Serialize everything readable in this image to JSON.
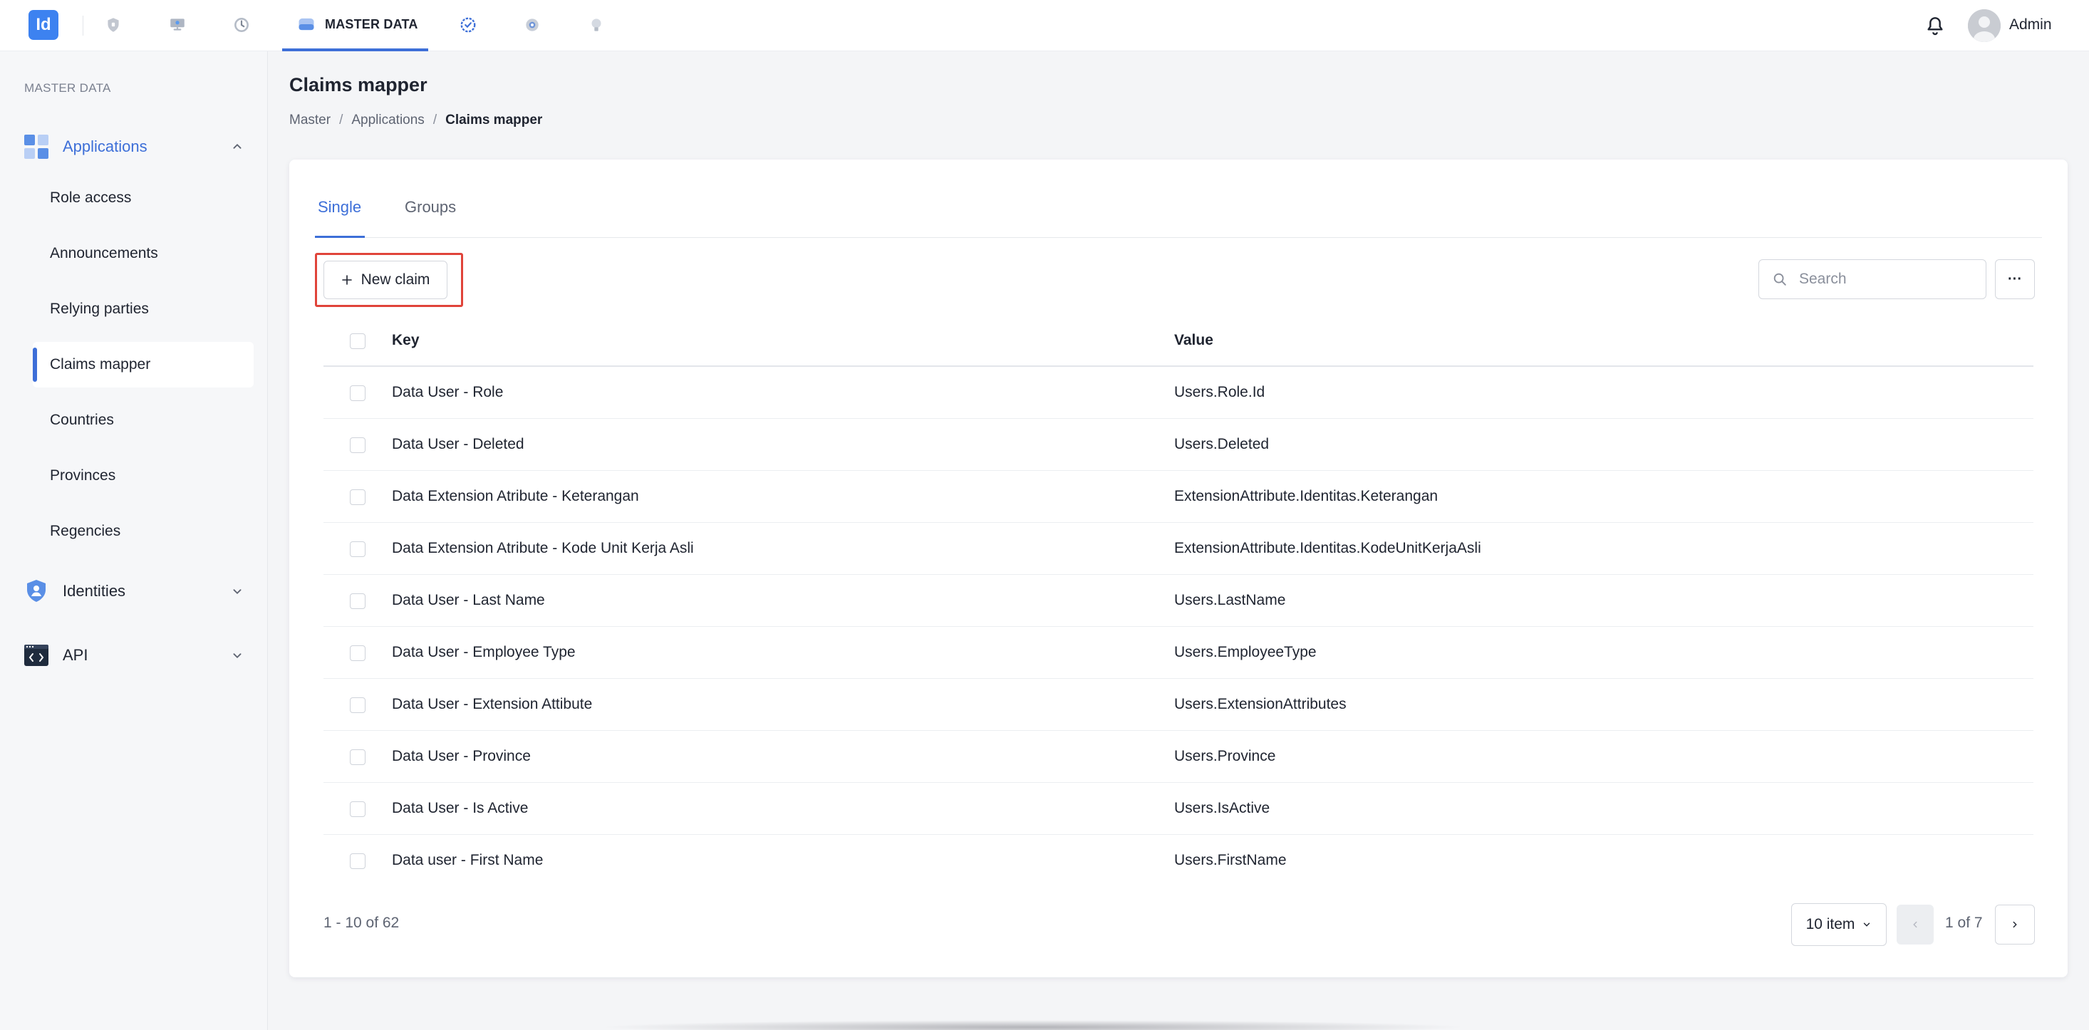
{
  "app": {
    "logo_text": "Id",
    "accent_color": "#3d6fd8",
    "logo_color": "#3d82f0"
  },
  "topbar": {
    "icons": [
      "shield-icon",
      "desktop-user-icon",
      "history-icon",
      "database-icon",
      "check-circle-icon",
      "gear-icon",
      "lightbulb-icon"
    ],
    "active_label": "MASTER DATA",
    "user_name": "Admin"
  },
  "sidebar": {
    "section_label": "MASTER DATA",
    "groups": [
      {
        "label": "Applications",
        "icon": "grid-apps-icon",
        "expanded": true,
        "items": [
          {
            "label": "Role access",
            "active": false
          },
          {
            "label": "Announcements",
            "active": false
          },
          {
            "label": "Relying parties",
            "active": false
          },
          {
            "label": "Claims mapper",
            "active": true
          },
          {
            "label": "Countries",
            "active": false
          },
          {
            "label": "Provinces",
            "active": false
          },
          {
            "label": "Regencies",
            "active": false
          }
        ]
      },
      {
        "label": "Identities",
        "icon": "identity-shield-icon",
        "expanded": false
      },
      {
        "label": "API",
        "icon": "code-window-icon",
        "expanded": false
      }
    ]
  },
  "page": {
    "title": "Claims mapper",
    "breadcrumb": [
      "Master",
      "Applications",
      "Claims mapper"
    ],
    "breadcrumb_separator": "/"
  },
  "tabs": [
    {
      "label": "Single",
      "active": true
    },
    {
      "label": "Groups",
      "active": false
    }
  ],
  "toolbar": {
    "new_claim_label": "New claim",
    "search_placeholder": "Search",
    "more_label": "···"
  },
  "table": {
    "columns": [
      "Key",
      "Value"
    ],
    "rows": [
      {
        "key": "Data User - Role",
        "value": "Users.Role.Id"
      },
      {
        "key": "Data User - Deleted",
        "value": "Users.Deleted"
      },
      {
        "key": "Data Extension Atribute - Keterangan",
        "value": "ExtensionAttribute.Identitas.Keterangan"
      },
      {
        "key": "Data Extension Atribute - Kode Unit Kerja Asli",
        "value": "ExtensionAttribute.Identitas.KodeUnitKerjaAsli"
      },
      {
        "key": "Data User - Last Name",
        "value": "Users.LastName"
      },
      {
        "key": "Data User - Employee Type",
        "value": "Users.EmployeeType"
      },
      {
        "key": "Data User - Extension Attibute",
        "value": "Users.ExtensionAttributes"
      },
      {
        "key": "Data User - Province",
        "value": "Users.Province"
      },
      {
        "key": "Data User - Is Active",
        "value": "Users.IsActive"
      },
      {
        "key": "Data user - First Name",
        "value": "Users.FirstName"
      }
    ]
  },
  "pagination": {
    "range_text": "1 - 10 of 62",
    "per_page": "10 item",
    "page_text": "1 of 7"
  }
}
